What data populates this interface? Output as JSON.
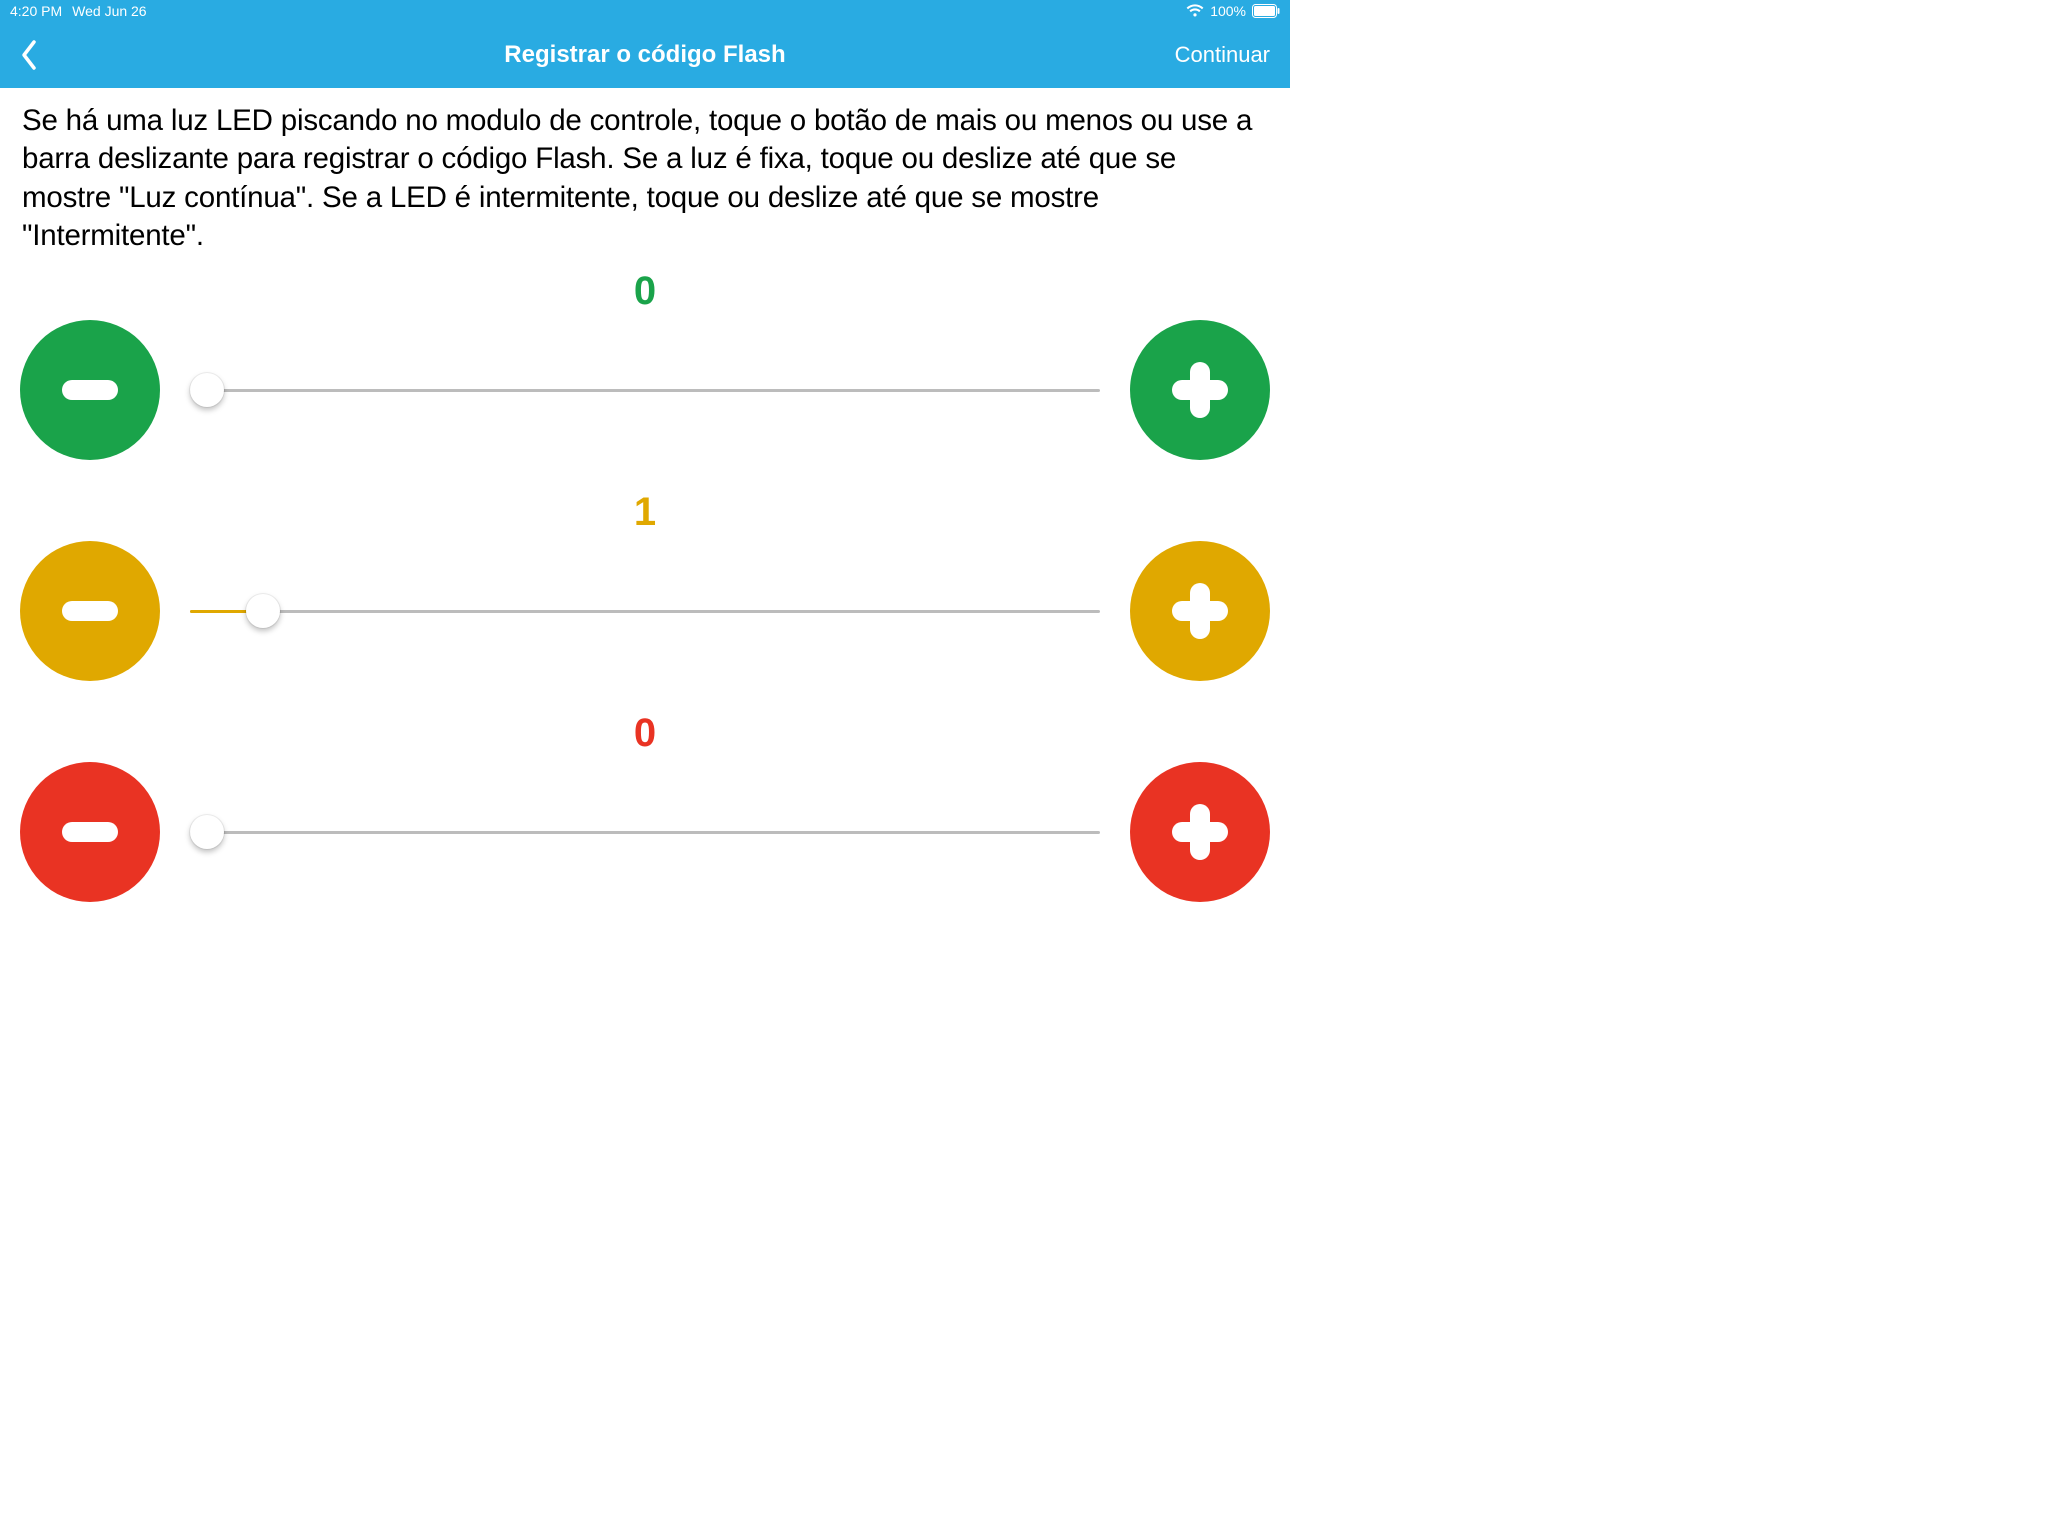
{
  "status": {
    "time": "4:20 PM",
    "date": "Wed Jun 26",
    "battery": "100%"
  },
  "nav": {
    "title": "Registrar o código Flash",
    "continue": "Continuar"
  },
  "instructions": "Se há uma luz LED piscando no modulo de controle, toque o botão de mais ou menos ou use a barra deslizante para registrar o código Flash. Se a luz é fixa, toque ou deslize até que se mostre \"Luz contínua\". Se a LED é intermitente, toque ou deslize até que se mostre \"Intermitente\".",
  "sliders": {
    "green": {
      "value": "0",
      "percent": 0
    },
    "amber": {
      "value": "1",
      "percent": 8
    },
    "red": {
      "value": "0",
      "percent": 0
    }
  },
  "colors": {
    "green": "#1aa34a",
    "amber": "#e0a800",
    "red": "#e93323",
    "bar": "#29abe2"
  }
}
